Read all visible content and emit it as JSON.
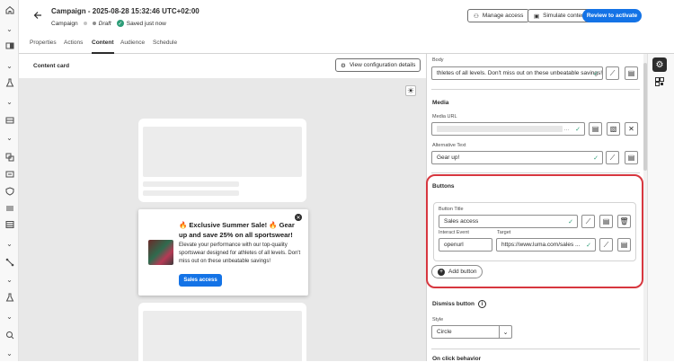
{
  "header": {
    "title": "Campaign - 2025-08-28 15:32:46 UTC+02:00",
    "type": "Campaign",
    "status": "Draft",
    "save_status": "Saved just now",
    "manage_access": "Manage access",
    "simulate_content": "Simulate content",
    "review": "Review to activate"
  },
  "tabs": [
    "Properties",
    "Actions",
    "Content",
    "Audience",
    "Schedule"
  ],
  "active_tab": "Content",
  "canvas": {
    "label": "Content card",
    "view_config": "View configuration details"
  },
  "preview": {
    "title": "🔥 Exclusive Summer Sale! 🔥 Gear up and save 25% on all sportswear!",
    "body": "Elevate your performance with our top-quality sportswear designed for athletes of all levels. Don't miss out on these unbeatable savings!",
    "button": "Sales access"
  },
  "panel": {
    "body_label": "Body",
    "body_value": "thletes of all levels. Don't miss out on these unbeatable savings!",
    "media_section": "Media",
    "media_url_label": "Media URL",
    "media_url_value": "",
    "alt_text_label": "Alternative Text",
    "alt_text_value": "Gear up!",
    "buttons_section": "Buttons",
    "button_title_label": "Button Title",
    "button_title_value": "Sales access",
    "interact_event_label": "Interact Event",
    "interact_event_value": "openurl",
    "target_label": "Target",
    "target_value": "https://www.luma.com/sales ...",
    "add_button": "Add button",
    "dismiss_section": "Dismiss button",
    "style_label": "Style",
    "style_value": "Circle",
    "onclick_section": "On click behavior"
  },
  "colors": {
    "accent": "#1473e6",
    "highlight": "#d7373f",
    "success": "#2d9d78"
  }
}
